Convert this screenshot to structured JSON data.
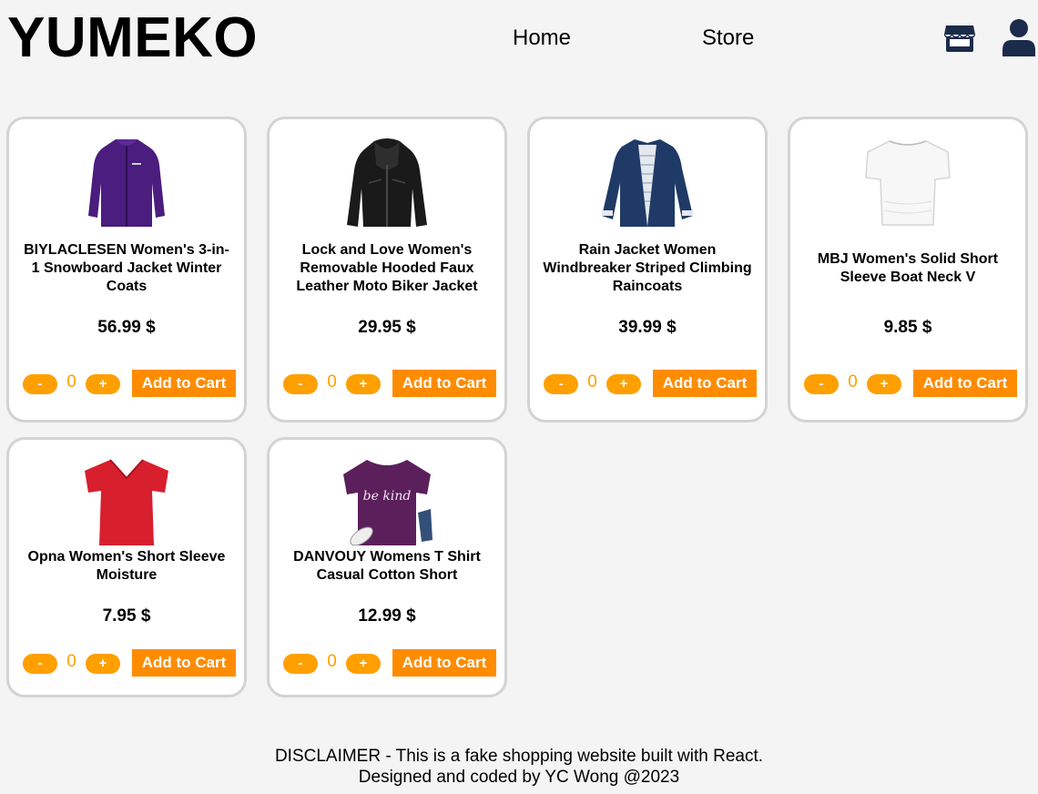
{
  "brand": "YUMEKO",
  "nav": {
    "home": "Home",
    "store": "Store"
  },
  "icons": {
    "store": "storefront-icon",
    "user": "user-icon"
  },
  "colors": {
    "accent": "#ff9f00",
    "add_button": "#ff8c00",
    "icon": "#1b2b4b"
  },
  "products": [
    {
      "title": "BIYLACLESEN Women's 3-in-1 Snowboard Jacket Winter Coats",
      "price": "56.99 $",
      "qty": "0",
      "image": "purple-jacket"
    },
    {
      "title": "Lock and Love Women's Removable Hooded Faux Leather Moto Biker Jacket",
      "price": "29.95 $",
      "qty": "0",
      "image": "black-leather-jacket"
    },
    {
      "title": "Rain Jacket Women Windbreaker Striped Climbing Raincoats",
      "price": "39.99 $",
      "qty": "0",
      "image": "navy-rain-jacket"
    },
    {
      "title": "MBJ Women's Solid Short Sleeve Boat Neck V",
      "price": "9.85 $",
      "qty": "0",
      "image": "white-tshirt"
    },
    {
      "title": "Opna Women's Short Sleeve Moisture",
      "price": "7.95 $",
      "qty": "0",
      "image": "red-tshirt"
    },
    {
      "title": "DANVOUY Womens T Shirt Casual Cotton Short",
      "price": "12.99 $",
      "qty": "0",
      "image": "purple-graphic-tshirt",
      "image_text": "be kind"
    }
  ],
  "buttons": {
    "minus": "-",
    "plus": "+",
    "add": "Add to Cart"
  },
  "footer": {
    "line1": "DISCLAIMER - This is a fake shopping website built with React.",
    "line2": "Designed and coded by YC Wong @2023"
  }
}
